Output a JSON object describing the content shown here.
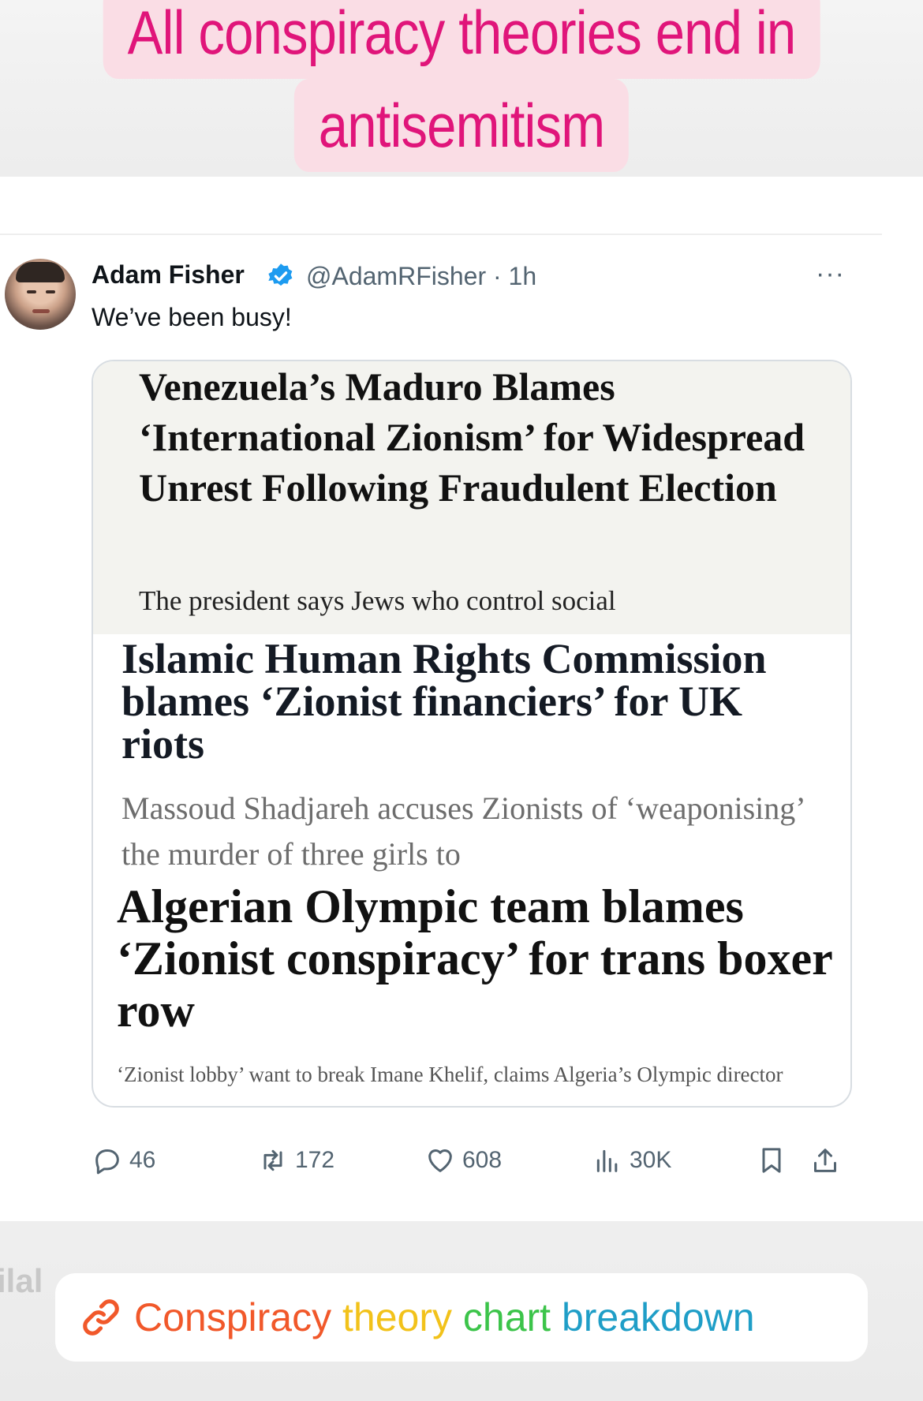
{
  "story": {
    "caption_line1": "All conspiracy theories end in",
    "caption_line2": "antisemitism",
    "partial_text": "ilal"
  },
  "tweet": {
    "author_name": "Adam Fisher",
    "handle_time": "@AdamRFisher · 1h",
    "more_label": "···",
    "text": "We’ve been busy!",
    "headlines": [
      {
        "title": "Venezuela’s Maduro Blames ‘International Zionism’ for Widespread Unrest Following Fraudulent Election",
        "subtitle": "The president says Jews who control social"
      },
      {
        "title": "Islamic Human Rights Commission blames ‘Zionist financiers’ for UK riots",
        "subtitle": "Massoud Shadjareh accuses Zionists of ‘weaponising’ the murder of three girls to"
      },
      {
        "title": "Algerian Olympic team blames ‘Zionist conspiracy’ for trans boxer row",
        "subtitle": "‘Zionist lobby’ want to break Imane Khelif, claims Algeria’s Olympic director"
      }
    ],
    "actions": {
      "replies": "46",
      "reposts": "172",
      "likes": "608",
      "views": "30K"
    }
  },
  "link_sticker": {
    "word1": "Conspiracy",
    "word2": "theory",
    "word3": "chart",
    "word4": "breakdown"
  },
  "colors": {
    "caption_bg": "#fadde5",
    "caption_text": "#e0157a",
    "verified": "#1d9bf0",
    "link_orange": "#f1582a",
    "link_yellow": "#f2c21a",
    "link_green": "#3cc44a",
    "link_blue": "#1f9ec7"
  }
}
